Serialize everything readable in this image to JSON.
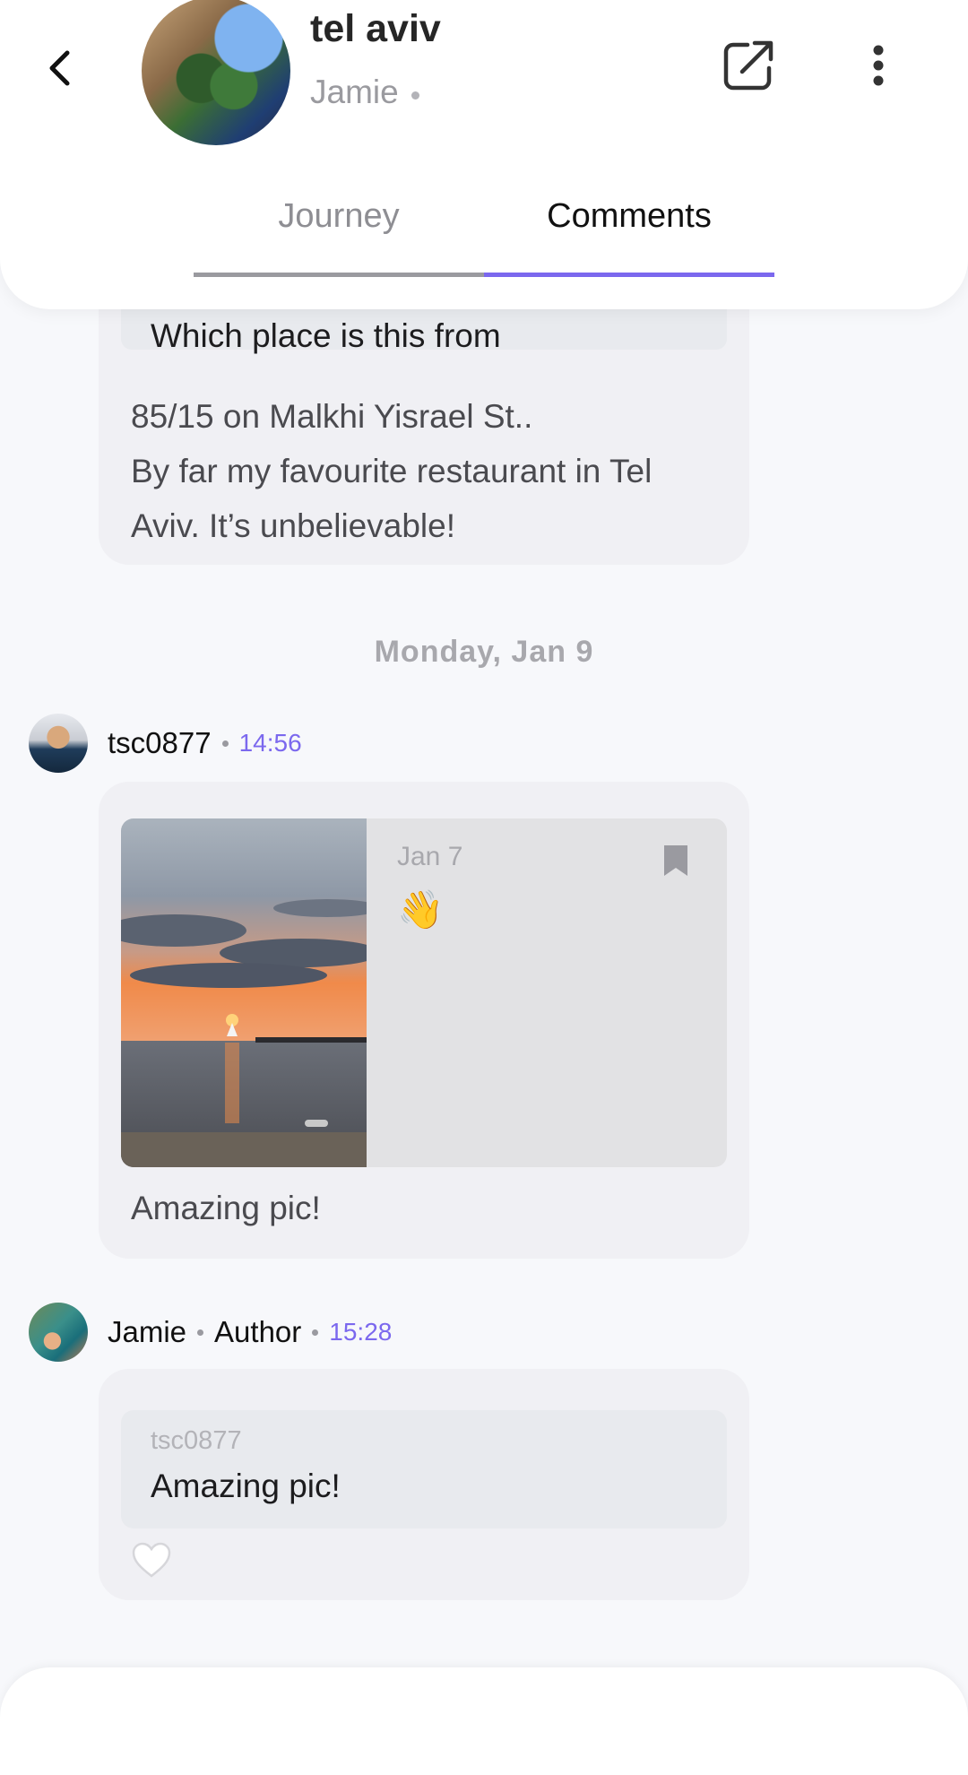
{
  "header": {
    "title": "tel aviv",
    "author_name": "Jamie",
    "tabs": [
      {
        "label": "Journey",
        "active": false
      },
      {
        "label": "Comments",
        "active": true
      }
    ]
  },
  "colors": {
    "accent": "#7b68ee",
    "bubble": "#f0f0f4",
    "quote": "#e8eaee"
  },
  "thread": {
    "first_message": {
      "quoted_text": "Which place is this from",
      "body_lines": [
        "85/15 on Malkhi Yisrael St..",
        "By far my favourite restaurant in Tel",
        "Aviv. It’s unbelievable!"
      ]
    },
    "date_separator": "Monday, Jan 9",
    "second_message": {
      "username": "tsc0877",
      "time": "14:56",
      "card": {
        "date": "Jan 7",
        "emoji": "👋",
        "icon": "bookmark-icon",
        "image": "sunset-sea-photo"
      },
      "caption": "Amazing pic!"
    },
    "third_message": {
      "username": "Jamie",
      "role": "Author",
      "time": "15:28",
      "quoted_user": "tsc0877",
      "quoted_text": "Amazing pic!",
      "reaction_icon": "heart-icon"
    }
  }
}
